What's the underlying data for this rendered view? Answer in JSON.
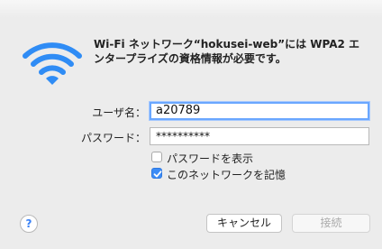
{
  "dialog": {
    "message": "Wi-Fi ネットワーク“hokusei-web”には WPA2 エンタープライズの資格情報が必要です。",
    "icon": "wifi-icon",
    "accent": "#2f8cf5"
  },
  "form": {
    "username_label": "ユーザ名：",
    "username_value": "a20789",
    "password_label": "パスワード：",
    "password_value": "**********"
  },
  "options": {
    "show_password_label": "パスワードを表示",
    "show_password_checked": false,
    "remember_label": "このネットワークを記憶",
    "remember_checked": true
  },
  "buttons": {
    "help": "?",
    "cancel": "キャンセル",
    "connect": "接続"
  }
}
